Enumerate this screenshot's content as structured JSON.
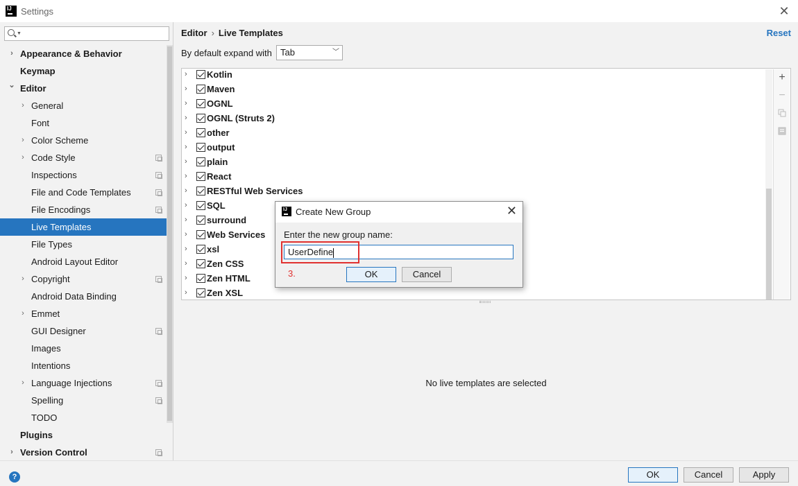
{
  "window": {
    "title": "Settings"
  },
  "search": {
    "placeholder": ""
  },
  "sidebar": {
    "items": [
      {
        "label": "Appearance & Behavior",
        "level": 0,
        "chevron": "right",
        "bold": true,
        "copy": false
      },
      {
        "label": "Keymap",
        "level": 0,
        "chevron": "none",
        "bold": true,
        "copy": false
      },
      {
        "label": "Editor",
        "level": 0,
        "chevron": "down",
        "bold": true,
        "copy": false
      },
      {
        "label": "General",
        "level": 1,
        "chevron": "right",
        "bold": false,
        "copy": false
      },
      {
        "label": "Font",
        "level": 1,
        "chevron": "none",
        "bold": false,
        "copy": false
      },
      {
        "label": "Color Scheme",
        "level": 1,
        "chevron": "right",
        "bold": false,
        "copy": false
      },
      {
        "label": "Code Style",
        "level": 1,
        "chevron": "right",
        "bold": false,
        "copy": true
      },
      {
        "label": "Inspections",
        "level": 1,
        "chevron": "none",
        "bold": false,
        "copy": true
      },
      {
        "label": "File and Code Templates",
        "level": 1,
        "chevron": "none",
        "bold": false,
        "copy": true
      },
      {
        "label": "File Encodings",
        "level": 1,
        "chevron": "none",
        "bold": false,
        "copy": true
      },
      {
        "label": "Live Templates",
        "level": 1,
        "chevron": "none",
        "bold": false,
        "copy": false,
        "selected": true
      },
      {
        "label": "File Types",
        "level": 1,
        "chevron": "none",
        "bold": false,
        "copy": false
      },
      {
        "label": "Android Layout Editor",
        "level": 1,
        "chevron": "none",
        "bold": false,
        "copy": false
      },
      {
        "label": "Copyright",
        "level": 1,
        "chevron": "right",
        "bold": false,
        "copy": true
      },
      {
        "label": "Android Data Binding",
        "level": 1,
        "chevron": "none",
        "bold": false,
        "copy": false
      },
      {
        "label": "Emmet",
        "level": 1,
        "chevron": "right",
        "bold": false,
        "copy": false
      },
      {
        "label": "GUI Designer",
        "level": 1,
        "chevron": "none",
        "bold": false,
        "copy": true
      },
      {
        "label": "Images",
        "level": 1,
        "chevron": "none",
        "bold": false,
        "copy": false
      },
      {
        "label": "Intentions",
        "level": 1,
        "chevron": "none",
        "bold": false,
        "copy": false
      },
      {
        "label": "Language Injections",
        "level": 1,
        "chevron": "right",
        "bold": false,
        "copy": true
      },
      {
        "label": "Spelling",
        "level": 1,
        "chevron": "none",
        "bold": false,
        "copy": true
      },
      {
        "label": "TODO",
        "level": 1,
        "chevron": "none",
        "bold": false,
        "copy": false
      },
      {
        "label": "Plugins",
        "level": 0,
        "chevron": "none",
        "bold": true,
        "copy": false
      },
      {
        "label": "Version Control",
        "level": 0,
        "chevron": "right",
        "bold": true,
        "copy": true
      }
    ]
  },
  "header": {
    "breadcrumb_root": "Editor",
    "breadcrumb_sep": "›",
    "breadcrumb_current": "Live Templates",
    "reset_label": "Reset"
  },
  "expand": {
    "label": "By default expand with",
    "value": "Tab"
  },
  "groups": [
    "Kotlin",
    "Maven",
    "OGNL",
    "OGNL (Struts 2)",
    "other",
    "output",
    "plain",
    "React",
    "RESTful Web Services",
    "SQL",
    "surround",
    "Web Services",
    "xsl",
    "Zen CSS",
    "Zen HTML",
    "Zen XSL"
  ],
  "toolbar": {
    "add": "+",
    "remove": "−"
  },
  "empty_message": "No live templates are selected",
  "dialog": {
    "title": "Create New Group",
    "label": "Enter the new group name:",
    "input_value": "UserDefine",
    "step_annotation": "3.",
    "ok_label": "OK",
    "cancel_label": "Cancel",
    "highlight_color": "#e0312f"
  },
  "footer": {
    "help": "?",
    "ok_label": "OK",
    "cancel_label": "Cancel",
    "apply_label": "Apply"
  },
  "colors": {
    "accent": "#2675bf"
  }
}
